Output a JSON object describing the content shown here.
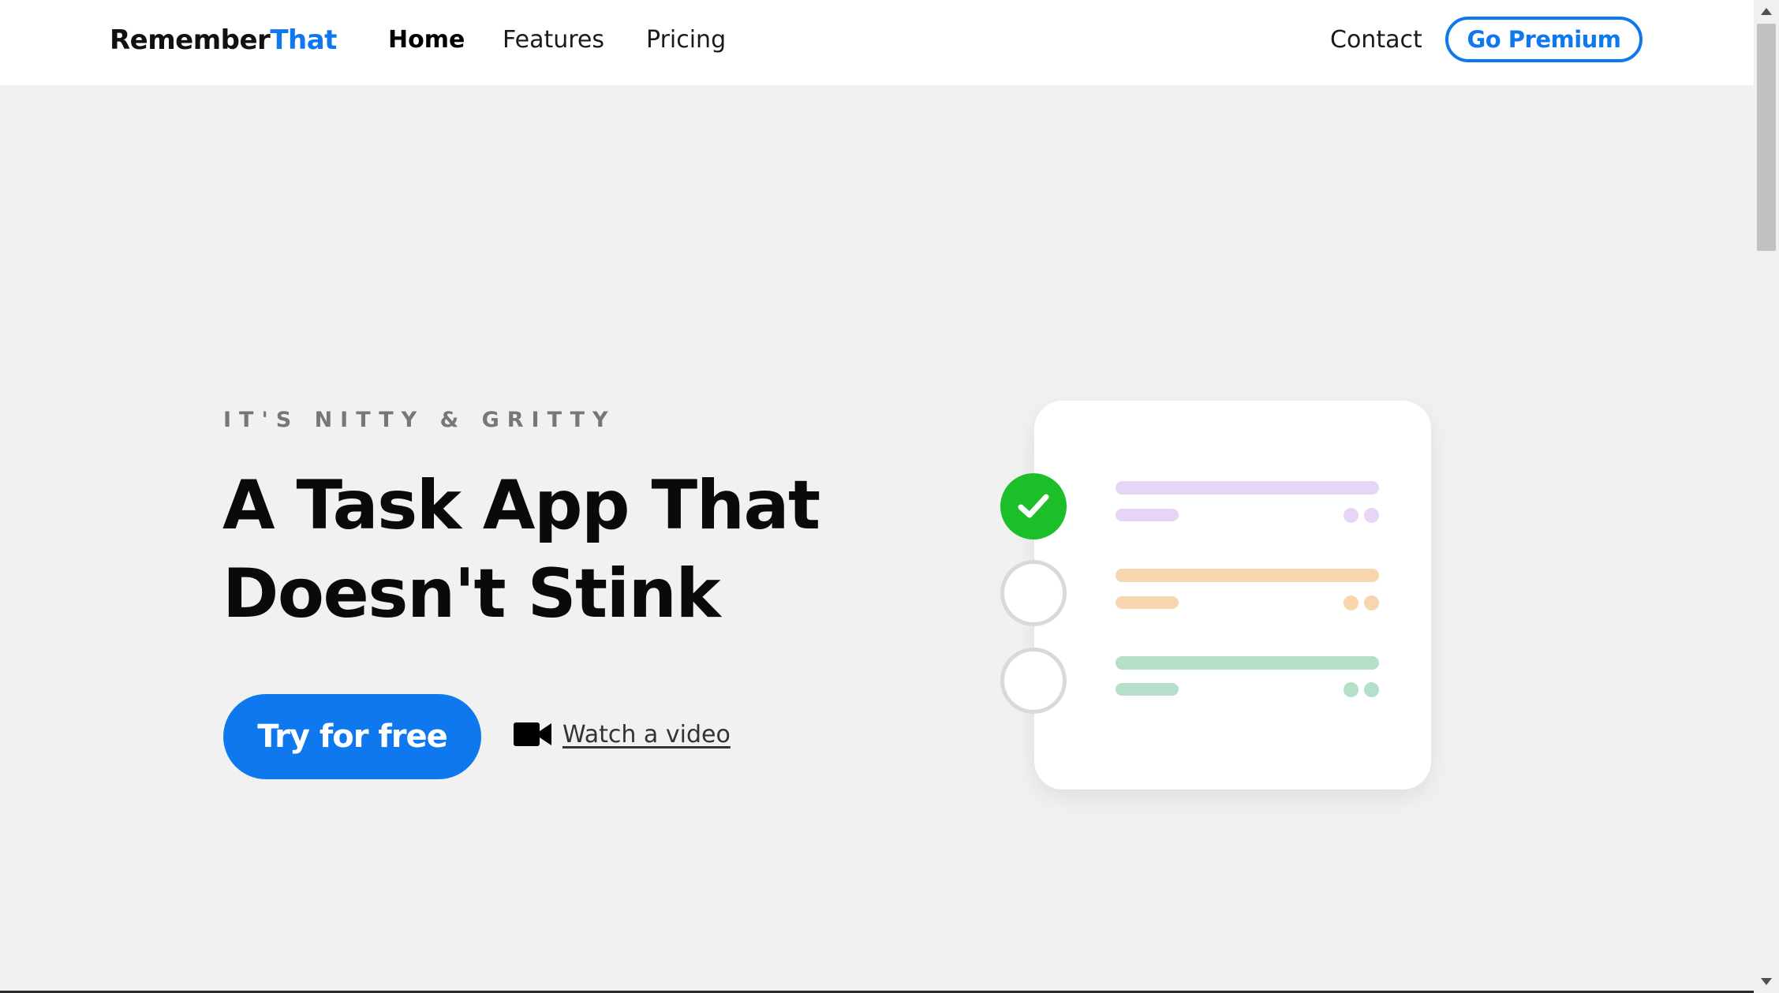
{
  "header": {
    "logo_primary": "Remember",
    "logo_accent": "That",
    "nav": {
      "home": "Home",
      "features": "Features",
      "pricing": "Pricing",
      "contact": "Contact"
    },
    "premium_label": "Go Premium"
  },
  "hero": {
    "eyebrow": "IT'S NITTY & GRITTY",
    "headline_line1": "A Task App That",
    "headline_line2": "Doesn't Stink",
    "cta_label": "Try for free",
    "video_label": "Watch a video",
    "video_icon": "video-camera-icon"
  },
  "illustration": {
    "tasks": [
      {
        "state": "done",
        "color": "#e6d5f5"
      },
      {
        "state": "open",
        "color": "#f8d6ad"
      },
      {
        "state": "open",
        "color": "#b4dfc8"
      }
    ],
    "check_icon": "checkmark-icon"
  },
  "colors": {
    "accent": "#0f78ee",
    "background": "#f1f1f1",
    "done_green": "#1dbf29"
  }
}
